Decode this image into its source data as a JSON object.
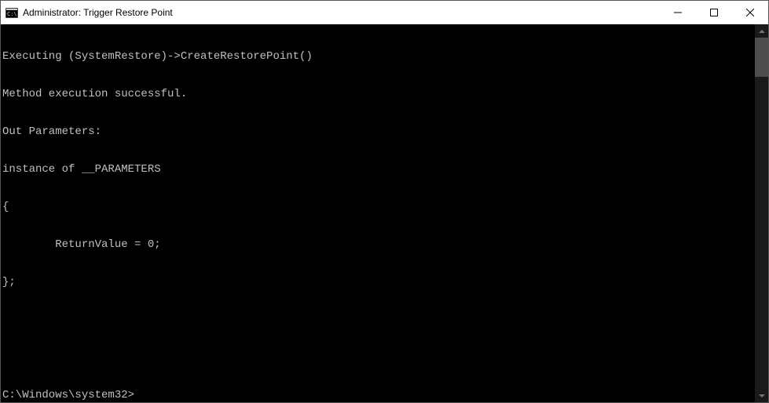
{
  "window": {
    "title": "Administrator: Trigger Restore Point"
  },
  "console": {
    "lines": [
      "Executing (SystemRestore)->CreateRestorePoint()",
      "Method execution successful.",
      "Out Parameters:",
      "instance of __PARAMETERS",
      "{",
      "        ReturnValue = 0;",
      "};",
      "",
      ""
    ],
    "prompt": "C:\\Windows\\system32>"
  },
  "controls": {
    "minimize": "—",
    "maximize": "☐",
    "close": "✕"
  }
}
